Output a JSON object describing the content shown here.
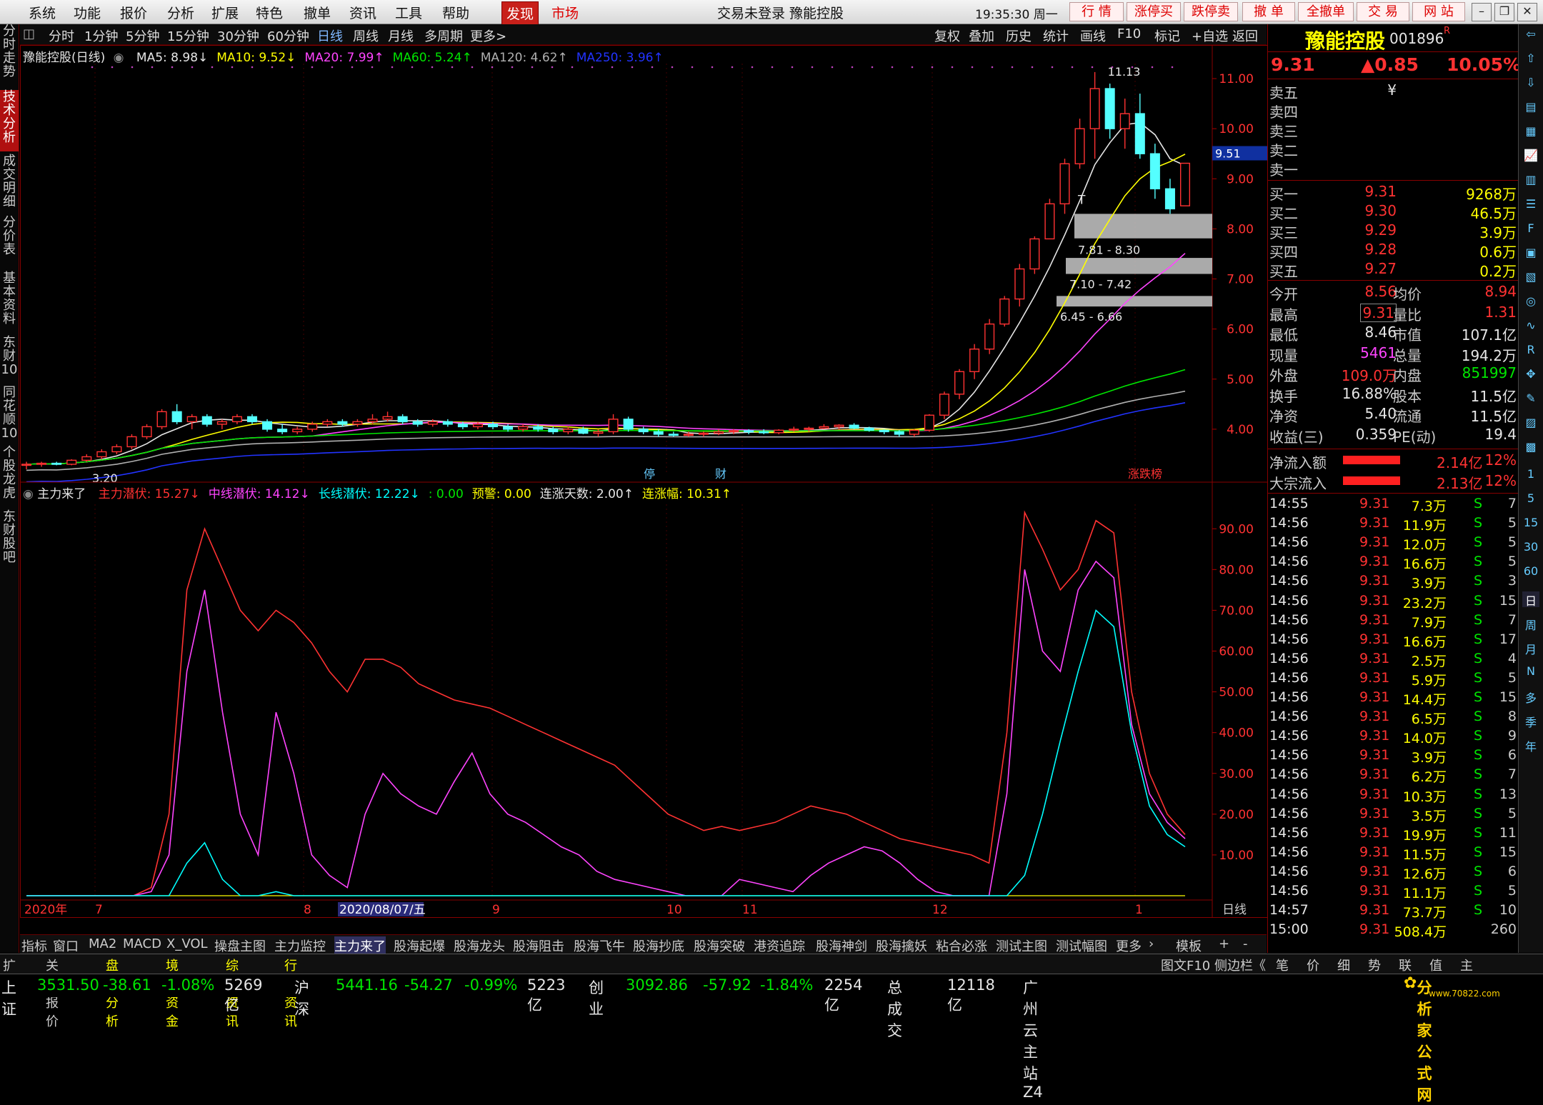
{
  "menu": {
    "items": [
      "系统",
      "功能",
      "报价",
      "分析",
      "扩展",
      "特色",
      "撤单",
      "资讯",
      "工具",
      "帮助"
    ],
    "discover": "发现",
    "market": "市场",
    "title": "交易未登录 豫能控股",
    "clock": "19:35:30 周一",
    "right_buttons": [
      "行 情",
      "涨停买",
      "跌停卖",
      "撤 单",
      "全撤单",
      "交 易",
      "网 站"
    ]
  },
  "period_bar": {
    "items": [
      "分时",
      "1分钟",
      "5分钟",
      "15分钟",
      "30分钟",
      "60分钟",
      "日线",
      "周线",
      "月线",
      "多周期",
      "更多>"
    ],
    "selected": "日线",
    "tools": [
      "复权",
      "叠加",
      "历史",
      "统计",
      "画线",
      "F10",
      "标记",
      "+自选",
      "返回"
    ]
  },
  "left_tabs": [
    {
      "label": "分时走势",
      "active": false
    },
    {
      "label": "技术分析",
      "active": true
    },
    {
      "label": "成交明细",
      "active": false
    },
    {
      "label": "分价表",
      "active": false
    },
    {
      "label": "基本资料",
      "active": false
    },
    {
      "label": "东财10",
      "active": false
    },
    {
      "label": "同花顺10",
      "active": false
    },
    {
      "label": "个股龙虎",
      "active": false
    },
    {
      "label": "东财股吧",
      "active": false
    }
  ],
  "main_header": {
    "name": "豫能控股(日线)",
    "mas": [
      {
        "label": "MA5: 8.98↓",
        "color": "#e6e6e6"
      },
      {
        "label": "MA10: 9.52↓",
        "color": "#ffff00"
      },
      {
        "label": "MA20: 7.99↑",
        "color": "#ff44ff"
      },
      {
        "label": "MA60: 5.24↑",
        "color": "#00e600"
      },
      {
        "label": "MA120: 4.62↑",
        "color": "#b0b0b0"
      },
      {
        "label": "MA250: 3.96↑",
        "color": "#2233ff"
      }
    ]
  },
  "sub_header": {
    "name": "主力来了",
    "items": [
      {
        "label": "主力潜伏: 15.27↓",
        "color": "#ff3232"
      },
      {
        "label": "中线潜伏: 14.12↓",
        "color": "#ff44ff"
      },
      {
        "label": "长线潜伏: 12.22↓",
        "color": "#00ffff"
      },
      {
        "label": ": 0.00",
        "color": "#00e600"
      },
      {
        "label": "预警: 0.00",
        "color": "#ffff00"
      },
      {
        "label": "连涨天数: 2.00↑",
        "color": "#e6e6e6"
      },
      {
        "label": "连涨幅: 10.31↑",
        "color": "#ffff00"
      }
    ]
  },
  "chart_data": [
    {
      "type": "candlestick",
      "title": "豫能控股(日线)",
      "y_ticks": [
        "11.00",
        "10.00",
        "9.00",
        "8.00",
        "7.00",
        "6.00",
        "5.00",
        "4.00"
      ],
      "ylim": [
        3.1,
        11.3
      ],
      "current_price_marker": "9.51",
      "annotations": [
        "11.13",
        "3.20",
        "7.81 - 8.30",
        "7.10 - 7.42",
        "6.45 - 6.66",
        "T"
      ],
      "events": [
        "停",
        "财",
        "涨跌榜"
      ],
      "gaps": [
        [
          7.81,
          8.3
        ],
        [
          7.1,
          7.42
        ],
        [
          6.45,
          6.66
        ]
      ],
      "candles": [
        [
          3.3,
          3.35,
          3.2,
          3.3
        ],
        [
          3.3,
          3.35,
          3.25,
          3.32
        ],
        [
          3.32,
          3.35,
          3.28,
          3.3
        ],
        [
          3.3,
          3.4,
          3.28,
          3.38
        ],
        [
          3.38,
          3.5,
          3.35,
          3.45
        ],
        [
          3.45,
          3.6,
          3.4,
          3.55
        ],
        [
          3.55,
          3.7,
          3.5,
          3.65
        ],
        [
          3.65,
          3.9,
          3.6,
          3.85
        ],
        [
          3.85,
          4.1,
          3.8,
          4.05
        ],
        [
          4.05,
          4.4,
          4.0,
          4.35
        ],
        [
          4.35,
          4.5,
          4.1,
          4.15
        ],
        [
          4.15,
          4.3,
          4.0,
          4.25
        ],
        [
          4.25,
          4.3,
          4.05,
          4.1
        ],
        [
          4.1,
          4.2,
          4.0,
          4.15
        ],
        [
          4.15,
          4.3,
          4.1,
          4.25
        ],
        [
          4.25,
          4.3,
          4.1,
          4.15
        ],
        [
          4.15,
          4.2,
          3.95,
          4.0
        ],
        [
          4.0,
          4.1,
          3.9,
          3.95
        ],
        [
          3.95,
          4.05,
          3.9,
          4.0
        ],
        [
          4.0,
          4.15,
          3.95,
          4.1
        ],
        [
          4.1,
          4.2,
          4.05,
          4.15
        ],
        [
          4.15,
          4.2,
          4.05,
          4.1
        ],
        [
          4.1,
          4.2,
          4.05,
          4.15
        ],
        [
          4.15,
          4.3,
          4.1,
          4.2
        ],
        [
          4.2,
          4.35,
          4.15,
          4.25
        ],
        [
          4.25,
          4.3,
          4.1,
          4.15
        ],
        [
          4.15,
          4.2,
          4.05,
          4.1
        ],
        [
          4.1,
          4.2,
          4.05,
          4.15
        ],
        [
          4.15,
          4.2,
          4.05,
          4.1
        ],
        [
          4.1,
          4.15,
          4.0,
          4.05
        ],
        [
          4.05,
          4.15,
          4.0,
          4.1
        ],
        [
          4.1,
          4.15,
          4.0,
          4.05
        ],
        [
          4.05,
          4.1,
          3.95,
          4.0
        ],
        [
          4.0,
          4.1,
          3.95,
          4.05
        ],
        [
          4.05,
          4.1,
          3.95,
          4.0
        ],
        [
          4.0,
          4.05,
          3.9,
          3.95
        ],
        [
          3.95,
          4.05,
          3.9,
          4.0
        ],
        [
          4.0,
          4.05,
          3.9,
          3.92
        ],
        [
          3.92,
          4.0,
          3.85,
          3.95
        ],
        [
          3.95,
          4.3,
          3.9,
          4.2
        ],
        [
          4.2,
          4.25,
          3.95,
          4.0
        ],
        [
          4.0,
          4.05,
          3.9,
          3.95
        ],
        [
          3.95,
          4.0,
          3.85,
          3.9
        ],
        [
          3.9,
          3.95,
          3.85,
          3.88
        ],
        [
          3.88,
          3.95,
          3.85,
          3.9
        ],
        [
          3.9,
          3.95,
          3.85,
          3.92
        ],
        [
          3.92,
          4.0,
          3.88,
          3.95
        ],
        [
          3.95,
          4.0,
          3.9,
          3.97
        ],
        [
          3.97,
          4.0,
          3.9,
          3.95
        ],
        [
          3.95,
          4.0,
          3.9,
          3.93
        ],
        [
          3.93,
          4.0,
          3.9,
          3.98
        ],
        [
          3.98,
          4.05,
          3.95,
          4.0
        ],
        [
          4.0,
          4.05,
          3.95,
          4.02
        ],
        [
          4.02,
          4.1,
          4.0,
          4.05
        ],
        [
          4.05,
          4.1,
          4.0,
          4.08
        ],
        [
          4.08,
          4.12,
          4.0,
          4.02
        ],
        [
          4.02,
          4.05,
          3.95,
          3.98
        ],
        [
          3.98,
          4.0,
          3.9,
          3.95
        ],
        [
          3.95,
          3.98,
          3.85,
          3.9
        ],
        [
          3.9,
          4.0,
          3.85,
          3.98
        ],
        [
          3.98,
          4.3,
          3.95,
          4.28
        ],
        [
          4.28,
          4.75,
          4.2,
          4.7
        ],
        [
          4.7,
          5.2,
          4.6,
          5.15
        ],
        [
          5.15,
          5.7,
          5.0,
          5.6
        ],
        [
          5.6,
          6.2,
          5.5,
          6.1
        ],
        [
          6.1,
          6.66,
          6.05,
          6.6
        ],
        [
          6.6,
          7.3,
          6.45,
          7.2
        ],
        [
          7.2,
          7.85,
          7.1,
          7.8
        ],
        [
          7.8,
          8.6,
          7.81,
          8.5
        ],
        [
          8.5,
          9.4,
          8.3,
          9.3
        ],
        [
          9.3,
          10.2,
          9.2,
          10.0
        ],
        [
          10.0,
          11.13,
          9.4,
          10.8
        ],
        [
          10.8,
          10.9,
          9.8,
          10.0
        ],
        [
          10.0,
          10.6,
          9.6,
          10.3
        ],
        [
          10.3,
          10.7,
          9.4,
          9.5
        ],
        [
          9.5,
          9.7,
          8.6,
          8.8
        ],
        [
          8.8,
          9.0,
          8.3,
          8.4
        ],
        [
          8.46,
          9.31,
          8.46,
          9.31
        ]
      ]
    },
    {
      "type": "line",
      "title": "主力来了",
      "y_ticks": [
        "90.00",
        "80.00",
        "70.00",
        "60.00",
        "50.00",
        "40.00",
        "30.00",
        "20.00",
        "10.00"
      ],
      "ylim": [
        0,
        96
      ],
      "x_labels": [
        "2020年",
        "7",
        "8",
        "2020/08/07/五",
        "9",
        "10",
        "11",
        "12",
        "1"
      ],
      "series": [
        {
          "name": "主力潜伏",
          "color": "#ff3232",
          "values": [
            0,
            0,
            0,
            0,
            0,
            0,
            0,
            2,
            20,
            75,
            90,
            80,
            70,
            65,
            70,
            67,
            62,
            55,
            50,
            58,
            58,
            56,
            52,
            50,
            48,
            47,
            46,
            44,
            42,
            40,
            38,
            36,
            34,
            32,
            28,
            24,
            20,
            18,
            16,
            17,
            16,
            17,
            18,
            20,
            22,
            21,
            20,
            18,
            16,
            14,
            13,
            12,
            11,
            10,
            8,
            40,
            94,
            85,
            75,
            80,
            92,
            89,
            50,
            30,
            20,
            15
          ]
        },
        {
          "name": "中线潜伏",
          "color": "#ff44ff",
          "values": [
            0,
            0,
            0,
            0,
            0,
            0,
            0,
            1,
            10,
            55,
            75,
            45,
            20,
            10,
            45,
            30,
            10,
            5,
            2,
            20,
            30,
            25,
            22,
            20,
            28,
            35,
            25,
            20,
            18,
            15,
            12,
            10,
            6,
            4,
            3,
            2,
            1,
            0,
            0,
            0,
            4,
            3,
            2,
            1,
            5,
            8,
            10,
            12,
            11,
            8,
            4,
            1,
            0,
            0,
            0,
            25,
            80,
            60,
            55,
            75,
            82,
            78,
            42,
            25,
            18,
            14
          ]
        },
        {
          "name": "长线潜伏",
          "color": "#00ffff",
          "values": [
            0,
            0,
            0,
            0,
            0,
            0,
            0,
            0,
            0,
            8,
            13,
            4,
            0,
            0,
            1,
            0,
            0,
            0,
            0,
            0,
            0,
            0,
            0,
            0,
            0,
            0,
            0,
            0,
            0,
            0,
            0,
            0,
            0,
            0,
            0,
            0,
            0,
            0,
            0,
            0,
            0,
            0,
            0,
            0,
            0,
            0,
            0,
            0,
            0,
            0,
            0,
            0,
            0,
            0,
            0,
            0,
            5,
            20,
            38,
            55,
            70,
            66,
            40,
            22,
            15,
            12
          ]
        }
      ]
    }
  ],
  "quote": {
    "name": "豫能控股",
    "code": "001896",
    "code_sup": "R",
    "price": "9.31",
    "change": "▲0.85",
    "pct": "10.05%",
    "asks": [
      {
        "label": "卖五",
        "price": "¥",
        "vol": ""
      },
      {
        "label": "卖四",
        "price": "",
        "vol": ""
      },
      {
        "label": "卖三",
        "price": "",
        "vol": ""
      },
      {
        "label": "卖二",
        "price": "",
        "vol": ""
      },
      {
        "label": "卖一",
        "price": "",
        "vol": ""
      }
    ],
    "bids": [
      {
        "label": "买一",
        "price": "9.31",
        "vol": "9268万"
      },
      {
        "label": "买二",
        "price": "9.30",
        "vol": "46.5万"
      },
      {
        "label": "买三",
        "price": "9.29",
        "vol": "3.9万"
      },
      {
        "label": "买四",
        "price": "9.28",
        "vol": "0.6万"
      },
      {
        "label": "买五",
        "price": "9.27",
        "vol": "0.2万"
      }
    ],
    "stats": [
      {
        "l": "今开",
        "lv": "8.56",
        "lc": "#ff3232",
        "r": "均价",
        "rv": "8.94",
        "rc": "#ff3232"
      },
      {
        "l": "最高",
        "lv": "9.31",
        "lc": "#ff3232",
        "r": "量比",
        "rv": "1.31",
        "rc": "#ff3232"
      },
      {
        "l": "最低",
        "lv": "8.46",
        "lc": "#e6e6e6",
        "r": "市值",
        "rv": "107.1亿",
        "rc": "#e6e6e6"
      },
      {
        "l": "现量",
        "lv": "5461",
        "lc": "#ff44ff",
        "r": "总量",
        "rv": "194.2万",
        "rc": "#e6e6e6"
      },
      {
        "l": "外盘",
        "lv": "109.0万",
        "lc": "#ff3232",
        "r": "内盘",
        "rv": "851997",
        "rc": "#00e600"
      },
      {
        "l": "换手",
        "lv": "16.88%",
        "lc": "#e6e6e6",
        "r": "股本",
        "rv": "11.5亿",
        "rc": "#e6e6e6"
      },
      {
        "l": "净资",
        "lv": "5.40",
        "lc": "#e6e6e6",
        "r": "流通",
        "rv": "11.5亿",
        "rc": "#e6e6e6"
      },
      {
        "l": "收益(三)",
        "lv": "0.359",
        "lc": "#e6e6e6",
        "r": "PE(动)",
        "rv": "19.4",
        "rc": "#e6e6e6"
      }
    ],
    "flows": [
      {
        "label": "净流入额",
        "value": "2.14亿",
        "pct": "12%"
      },
      {
        "label": "大宗流入",
        "value": "2.13亿",
        "pct": "12%"
      }
    ]
  },
  "ticks": [
    [
      "14:55",
      "9.31",
      "7.3万",
      "S",
      "7"
    ],
    [
      "14:56",
      "9.31",
      "11.9万",
      "S",
      "5"
    ],
    [
      "14:56",
      "9.31",
      "12.0万",
      "S",
      "5"
    ],
    [
      "14:56",
      "9.31",
      "16.6万",
      "S",
      "5"
    ],
    [
      "14:56",
      "9.31",
      "3.9万",
      "S",
      "3"
    ],
    [
      "14:56",
      "9.31",
      "23.2万",
      "S",
      "15"
    ],
    [
      "14:56",
      "9.31",
      "7.9万",
      "S",
      "7"
    ],
    [
      "14:56",
      "9.31",
      "16.6万",
      "S",
      "17"
    ],
    [
      "14:56",
      "9.31",
      "2.5万",
      "S",
      "4"
    ],
    [
      "14:56",
      "9.31",
      "5.9万",
      "S",
      "5"
    ],
    [
      "14:56",
      "9.31",
      "14.4万",
      "S",
      "15"
    ],
    [
      "14:56",
      "9.31",
      "6.5万",
      "S",
      "8"
    ],
    [
      "14:56",
      "9.31",
      "14.0万",
      "S",
      "9"
    ],
    [
      "14:56",
      "9.31",
      "3.9万",
      "S",
      "6"
    ],
    [
      "14:56",
      "9.31",
      "6.2万",
      "S",
      "7"
    ],
    [
      "14:56",
      "9.31",
      "10.3万",
      "S",
      "13"
    ],
    [
      "14:56",
      "9.31",
      "3.5万",
      "S",
      "5"
    ],
    [
      "14:56",
      "9.31",
      "19.9万",
      "S",
      "11"
    ],
    [
      "14:56",
      "9.31",
      "11.5万",
      "S",
      "15"
    ],
    [
      "14:56",
      "9.31",
      "12.6万",
      "S",
      "6"
    ],
    [
      "14:56",
      "9.31",
      "11.1万",
      "S",
      "5"
    ],
    [
      "14:57",
      "9.31",
      "73.7万",
      "S",
      "10"
    ],
    [
      "15:00",
      "9.31",
      "508.4万",
      "",
      "260"
    ]
  ],
  "bottom_tabs": {
    "items": [
      "指标",
      "窗口",
      "MA2",
      "MACD",
      "X_VOL",
      "操盘主图",
      "主力监控",
      "主力来了",
      "股海起爆",
      "股海龙头",
      "股海阻击",
      "股海飞牛",
      "股海抄底",
      "股海突破",
      "港资追踪",
      "股海神剑",
      "股海擒妖",
      "粘合必涨",
      "测试主图",
      "测试幅图",
      "更多",
      "›",
      "模板",
      "+",
      "-"
    ],
    "selected": "主力来了"
  },
  "bottom2": {
    "left": [
      "扩展‹",
      "关联报价",
      "盘面分析",
      "境外资金",
      "综合资讯",
      "行业资讯"
    ],
    "mid": "图文F10",
    "mid2": "侧边栏《",
    "right": [
      "笔",
      "价",
      "细",
      "势",
      "联",
      "值",
      "主"
    ]
  },
  "status": {
    "items": [
      {
        "t": "上证",
        "c": "#e6e6e6"
      },
      {
        "t": "3531.50",
        "c": "#00e600"
      },
      {
        "t": "-38.61",
        "c": "#00e600"
      },
      {
        "t": "-1.08%",
        "c": "#00e600"
      },
      {
        "t": "5269亿",
        "c": "#e6e6e6"
      },
      {
        "t": "沪深",
        "c": "#e6e6e6"
      },
      {
        "t": "5441.16",
        "c": "#00e600"
      },
      {
        "t": "-54.27",
        "c": "#00e600"
      },
      {
        "t": "-0.99%",
        "c": "#00e600"
      },
      {
        "t": "5223亿",
        "c": "#e6e6e6"
      },
      {
        "t": "创业",
        "c": "#e6e6e6"
      },
      {
        "t": "3092.86",
        "c": "#00e600"
      },
      {
        "t": "-57.92",
        "c": "#00e600"
      },
      {
        "t": "-1.84%",
        "c": "#00e600"
      },
      {
        "t": "2254亿",
        "c": "#e6e6e6"
      },
      {
        "t": "总成交",
        "c": "#e6e6e6"
      },
      {
        "t": "12118亿",
        "c": "#e6e6e6"
      },
      {
        "t": "广州云主站Z4",
        "c": "#e6e6e6"
      }
    ],
    "watermark": "分析家公式网",
    "watermark_url": "www.70822.com"
  }
}
